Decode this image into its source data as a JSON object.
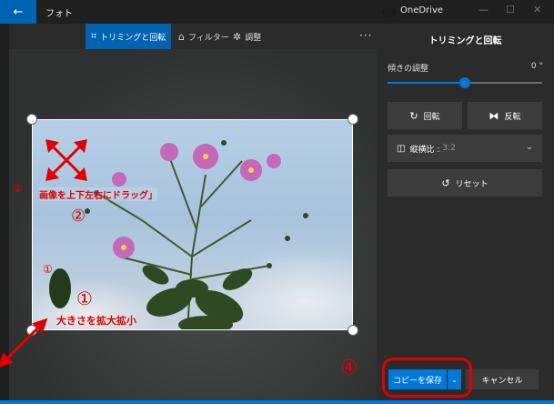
{
  "titlebar": {
    "back_glyph": "←",
    "app_title": "フォト",
    "onedrive_label": "OneDrive",
    "minimize_glyph": "—",
    "maximize_glyph": "☐",
    "close_glyph": "✕"
  },
  "toolbar": {
    "crop_label": "トリミングと回転",
    "filter_label": "フィルター",
    "adjust_label": "調整",
    "more_glyph": "···",
    "crop_icon": "crop-icon",
    "filter_icon": "filter-icon",
    "adjust_icon": "sun-icon"
  },
  "panel": {
    "title": "トリミングと回転",
    "tilt_label": "傾きの調整",
    "tilt_value": "0 °",
    "tilt_level": 0.5,
    "rotate_label": "回転",
    "flip_label": "反転",
    "aspect_label": "縦横比 :",
    "aspect_value": "3:2",
    "reset_label": "リセット",
    "save_label": "コピーを保存",
    "cancel_label": "キャンセル"
  },
  "annotations": {
    "circled_1": "①",
    "circled_2": "②",
    "circled_4": "④",
    "drag_text": "画像を上下左右にドラッグ」",
    "resize_text": "大きさを拡大拡小",
    "side_2": "②",
    "side_1": "①"
  },
  "colors": {
    "accent": "#0078d7",
    "annotation": "#e00000",
    "panel_bg": "#2b2b2b"
  }
}
